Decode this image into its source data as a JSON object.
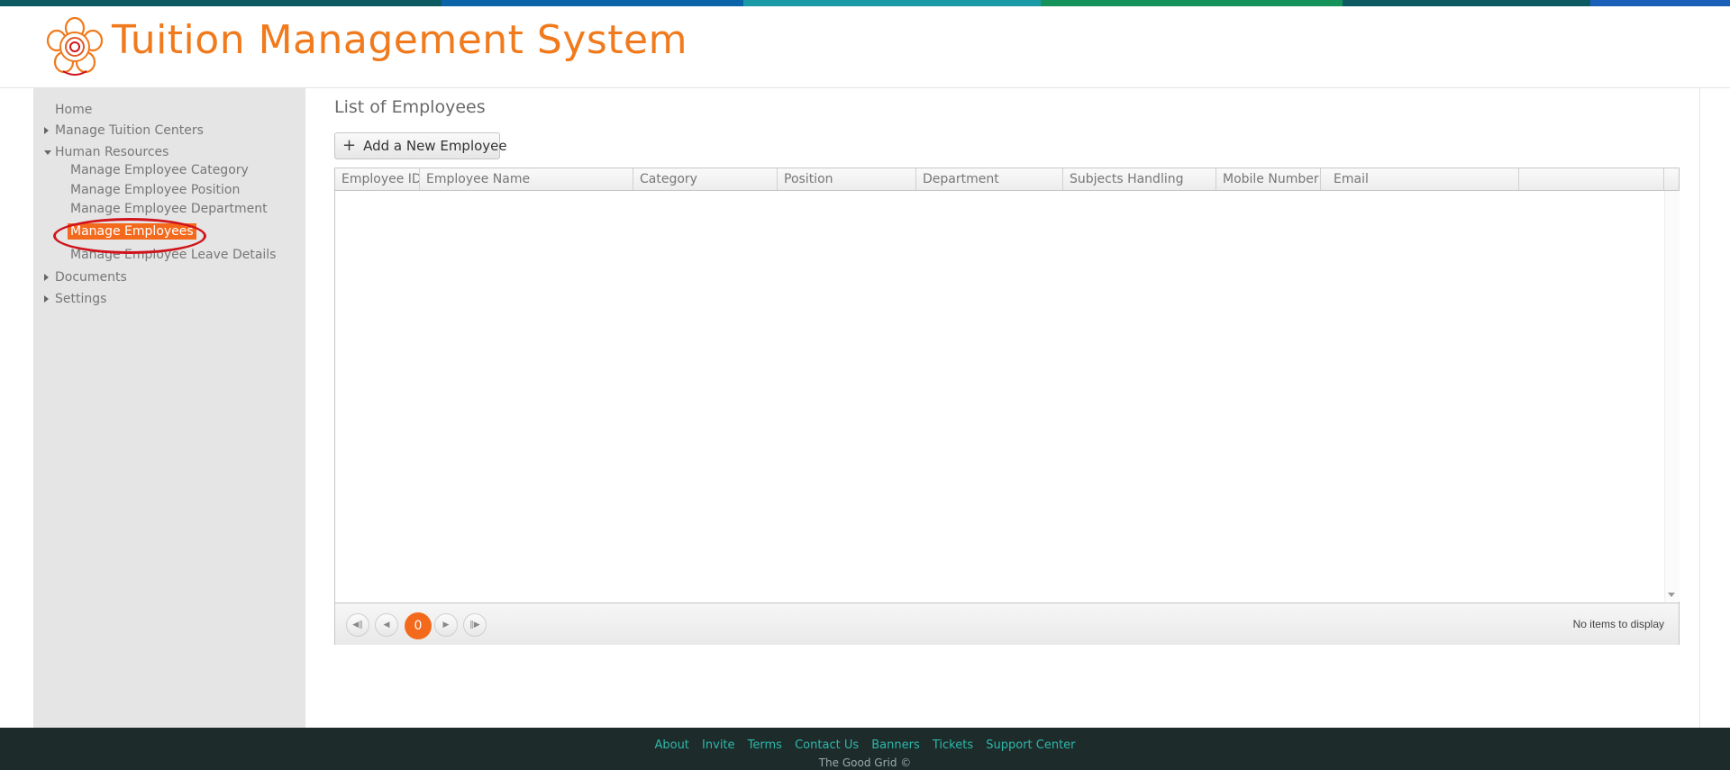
{
  "header": {
    "title": "Tuition Management System",
    "logo_icon": "flower-logo-icon",
    "accent_color": "#f07a1c",
    "top_bar_colors": [
      "#0d5a63",
      "#0b63a8",
      "#1a9aa6",
      "#14925a",
      "#0d5a63",
      "#1a60b8"
    ]
  },
  "sidebar": {
    "items": [
      {
        "label": "Home"
      },
      {
        "label": "Manage Tuition Centers"
      },
      {
        "label": "Human Resources"
      },
      {
        "label": "Manage Employee Category"
      },
      {
        "label": "Manage Employee Position"
      },
      {
        "label": "Manage Employee Department"
      },
      {
        "label": "Manage Employees",
        "active": true
      },
      {
        "label": "Manage Employee Leave Details"
      },
      {
        "label": "Documents"
      },
      {
        "label": "Settings"
      }
    ]
  },
  "main": {
    "page_title": "List of Employees",
    "add_button_label": "Add a New Employee",
    "grid": {
      "columns": [
        "Employee ID",
        "Employee Name",
        "Category",
        "Position",
        "Department",
        "Subjects Handling",
        "Mobile Number",
        "Email"
      ],
      "rows": []
    },
    "pager": {
      "current_page": "0",
      "info": "No items to display"
    }
  },
  "footer": {
    "links": [
      "About",
      "Invite",
      "Terms",
      "Contact Us",
      "Banners",
      "Tickets",
      "Support Center"
    ],
    "copyright": "The Good Grid ©",
    "link_color": "#2cb8a9"
  }
}
